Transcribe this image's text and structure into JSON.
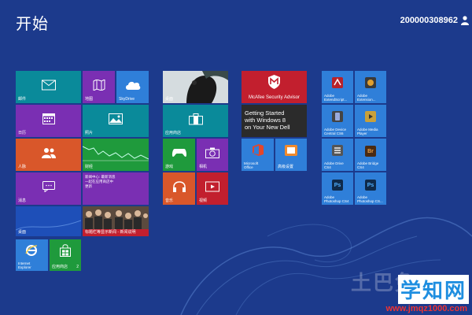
{
  "start": {
    "title": "开始"
  },
  "user": {
    "name": "200000308962"
  },
  "group1": {
    "mail": "邮件",
    "photos_cn": "地图",
    "skydrive": "SkyDrive",
    "calendar": "日历",
    "photos": "照片",
    "people": "人脉",
    "finance": "财经",
    "messaging": "消息",
    "weather_text": "新闻中心: 最新消息 一起在应用商店中更新",
    "desktop": "桌面",
    "news_headline": "标题栏等显示新闻 - 新闻说明",
    "ie_line1": "Internet",
    "ie_line2": "Explorer",
    "store": "应用商店",
    "store_badge": "2"
  },
  "group2": {
    "desktop_photo": "桌面",
    "store2": "应用商店",
    "xbox": "游戏",
    "camera": "相机",
    "music": "音乐",
    "video": "视频"
  },
  "group3": {
    "mcafee": "McAfee Security Advisor",
    "dell_line1": "Getting Started",
    "dell_line2": "with Windows 8",
    "dell_line3": "on Your New Dell",
    "office_line1": "Microsoft",
    "office_line2": "Office",
    "app2": "高级设置"
  },
  "group4": {
    "t1_l1": "Adobe",
    "t1_l2": "ExtendScript...",
    "t2_l1": "Adobe",
    "t2_l2": "Extension...",
    "t3_l1": "Adobe Device",
    "t3_l2": "Central CS6",
    "t4_l1": "Adobe Media",
    "t4_l2": "Player",
    "t5_l1": "Adobe Drive",
    "t5_l2": "CS4",
    "t6_l1": "Adobe Bridge",
    "t6_l2": "CS4",
    "t7_l1": "Adobe",
    "t7_l2": "Photoshop CS4",
    "t8_l1": "Adobe",
    "t8_l2": "Photoshop CS...",
    "br": "Br",
    "ps": "Ps"
  },
  "watermark": {
    "cn": "学知网",
    "url": "www.jmqz1000.com",
    "faint": "土巴兔"
  },
  "colors": {
    "background": "#1c3a8c",
    "teal": "#0a8a9a",
    "purple": "#7a2fb3",
    "orange": "#d9572a",
    "green": "#1f9a3c",
    "red": "#c21f2e",
    "blue": "#2f7fd9"
  }
}
